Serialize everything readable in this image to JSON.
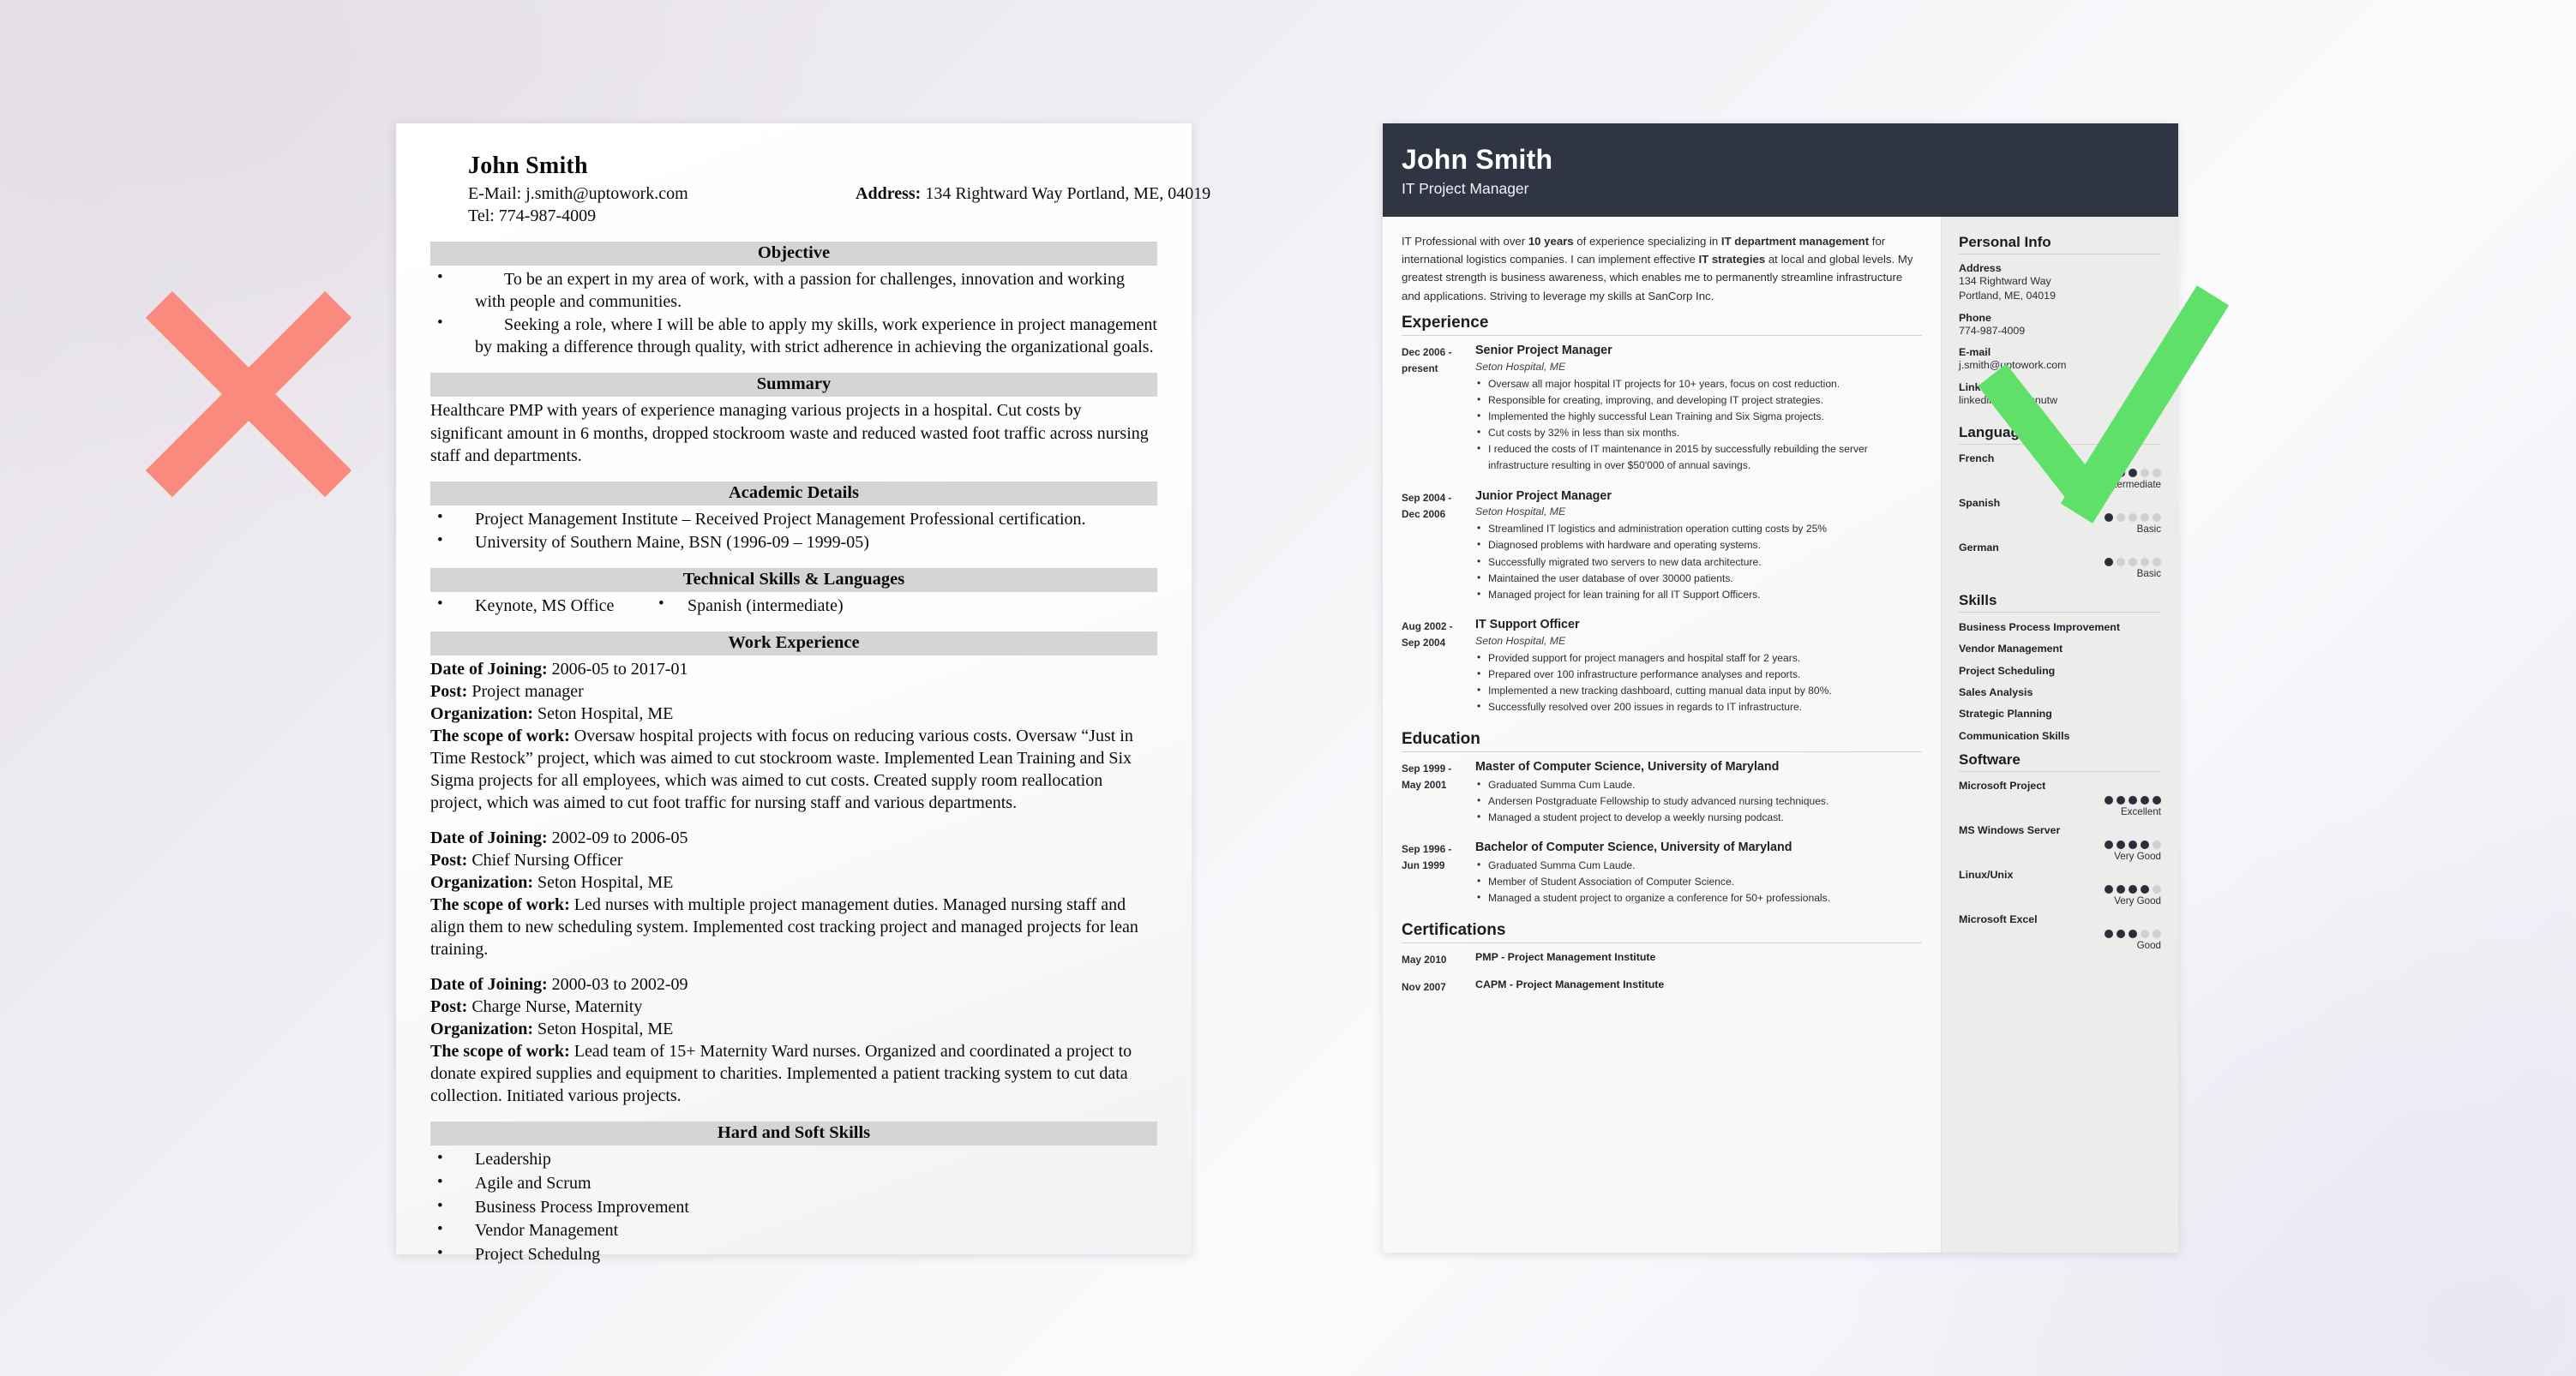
{
  "colors": {
    "background": "#eceaf3",
    "bad_mark": "#fa8a7e",
    "good_mark": "#5fe069",
    "right_header_bg": "#303544",
    "right_sidebar_bg": "#ececeb",
    "left_band_bg": "#d5d5d5",
    "dot_on": "#2b2e3b",
    "dot_off": "#d0d0d0"
  },
  "marks": {
    "bad": "red-x-mark",
    "good": "green-check-mark"
  },
  "bad_resume": {
    "name": "John Smith",
    "email_line": "E-Mail: j.smith@uptowork.com",
    "tel_line": "Tel: 774-987-4009",
    "address_label": "Address:",
    "address_value": "134 Rightward Way Portland, ME, 04019",
    "sections": {
      "objective": {
        "heading": "Objective",
        "items": [
          "To be an expert in my area of work, with a passion for challenges, innovation and working with people and communities.",
          "Seeking a role, where I will be able to apply my skills, work experience in project management by making a difference through quality, with strict adherence in achieving the organizational goals."
        ]
      },
      "summary": {
        "heading": "Summary",
        "text": "Healthcare PMP with years of experience managing various projects in a hospital. Cut costs by significant amount in 6 months, dropped stockroom waste and reduced wasted foot traffic across nursing staff and departments."
      },
      "academic": {
        "heading": "Academic Details",
        "items": [
          "Project Management Institute – Received Project Management Professional certification.",
          "University of Southern Maine, BSN (1996-09 – 1999-05)"
        ]
      },
      "technical": {
        "heading": "Technical Skills & Languages",
        "col1": "Keynote, MS Office",
        "col2": "Spanish (intermediate)"
      },
      "work": {
        "heading": "Work Experience",
        "jobs": [
          {
            "date_label": "Date of Joining:",
            "date_value": " 2006-05 to 2017-01",
            "post_label": "Post:",
            "post_value": " Project manager",
            "org_label": "Organization:",
            "org_value": " Seton Hospital, ME",
            "scope_label": "The scope of work:",
            "scope_value": " Oversaw hospital projects with focus on reducing various costs. Oversaw “Just in Time Restock” project, which was aimed to cut stockroom waste. Implemented Lean Training and Six Sigma projects for all employees, which was aimed to cut costs. Created supply room reallocation project, which was aimed to cut foot traffic for nursing staff and various departments."
          },
          {
            "date_label": "Date of Joining:",
            "date_value": " 2002-09 to 2006-05",
            "post_label": "Post:",
            "post_value": " Chief Nursing Officer",
            "org_label": "Organization:",
            "org_value": " Seton Hospital, ME",
            "scope_label": "The scope of work:",
            "scope_value": " Led nurses with multiple project management duties. Managed nursing staff and align them to new scheduling system. Implemented cost tracking project and managed projects for lean training."
          },
          {
            "date_label": "Date of Joining:",
            "date_value": " 2000-03 to 2002-09",
            "post_label": "Post:",
            "post_value": " Charge Nurse, Maternity",
            "org_label": "Organization:",
            "org_value": " Seton Hospital, ME",
            "scope_label": "The scope of work:",
            "scope_value": " Lead team of 15+ Maternity Ward nurses. Organized and coordinated a project to donate expired supplies and equipment to charities. Implemented a patient tracking system to cut data collection. Initiated various projects."
          }
        ]
      },
      "skills": {
        "heading": "Hard and Soft Skills",
        "items": [
          "Leadership",
          "Agile and Scrum",
          "Business Process Improvement",
          "Vendor Management",
          "Project Schedulng"
        ]
      }
    }
  },
  "good_resume": {
    "header": {
      "name": "John Smith",
      "role": "IT Project Manager"
    },
    "summary": {
      "part1": "IT Professional with over ",
      "b1": "10 years",
      "part2": " of experience specializing in ",
      "b2": "IT department management",
      "part3": " for international logistics companies. I can implement effective ",
      "b3": "IT strategies",
      "part4": " at local and global levels. My greatest strength is business awareness, which enables me to permanently streamline infrastructure and applications. Striving to leverage my skills at SanCorp Inc."
    },
    "experience": {
      "heading": "Experience",
      "entries": [
        {
          "date_from": "Dec 2006 -",
          "date_to": "present",
          "title": "Senior Project Manager",
          "org": "Seton Hospital, ME",
          "bullets": [
            "Oversaw all major hospital IT projects for 10+ years, focus on cost reduction.",
            "Responsible for creating, improving, and developing IT project strategies.",
            "Implemented the highly successful Lean Training and Six Sigma projects.",
            "Cut costs by 32% in less than six months.",
            "I reduced the costs of IT maintenance in 2015 by successfully rebuilding the server infrastructure resulting in over $50'000 of annual savings."
          ]
        },
        {
          "date_from": "Sep 2004 -",
          "date_to": "Dec 2006",
          "title": "Junior Project Manager",
          "org": "Seton Hospital, ME",
          "bullets": [
            "Streamlined IT logistics and administration operation cutting costs by 25%",
            "Diagnosed problems with hardware and operating systems.",
            "Successfully migrated two servers to new data architecture.",
            "Maintained the user database of over 30000 patients.",
            "Managed project for lean training for all IT Support Officers."
          ]
        },
        {
          "date_from": "Aug 2002 -",
          "date_to": "Sep 2004",
          "title": "IT Support Officer",
          "org": "Seton Hospital, ME",
          "bullets": [
            "Provided support for project managers and hospital staff for 2 years.",
            "Prepared over 100 infrastructure performance analyses and reports.",
            "Implemented a new tracking dashboard, cutting manual data input by 80%.",
            "Successfully resolved over 200 issues in regards to IT infrastructure."
          ]
        }
      ]
    },
    "education": {
      "heading": "Education",
      "entries": [
        {
          "date_from": "Sep 1999 -",
          "date_to": "May 2001",
          "title": "Master of Computer Science, University of Maryland",
          "bullets": [
            "Graduated Summa Cum Laude.",
            "Andersen Postgraduate Fellowship to study advanced nursing techniques.",
            "Managed a student project to develop a weekly nursing podcast."
          ]
        },
        {
          "date_from": "Sep 1996 -",
          "date_to": "Jun 1999",
          "title": "Bachelor of Computer Science, University of Maryland",
          "bullets": [
            "Graduated Summa Cum Laude.",
            "Member of Student Association of Computer Science.",
            "Managed a student project to organize a conference for 50+ professionals."
          ]
        }
      ]
    },
    "certifications": {
      "heading": "Certifications",
      "entries": [
        {
          "date": "May 2010",
          "name": "PMP - Project Management Institute"
        },
        {
          "date": "Nov 2007",
          "name": "CAPM - Project Management Institute"
        }
      ]
    },
    "sidebar": {
      "personal_info": {
        "heading": "Personal Info",
        "fields": [
          {
            "label": "Address",
            "value": "134 Rightward Way\nPortland, ME, 04019"
          },
          {
            "label": "Phone",
            "value": "774-987-4009"
          },
          {
            "label": "E-mail",
            "value": "j.smith@uptowork.com"
          },
          {
            "label": "LinkedIn",
            "value": "linkedin.com/johnutw"
          }
        ]
      },
      "languages": {
        "heading": "Languages",
        "items": [
          {
            "name": "French",
            "level": 3,
            "max": 5,
            "label": "Intermediate"
          },
          {
            "name": "Spanish",
            "level": 1,
            "max": 5,
            "label": "Basic"
          },
          {
            "name": "German",
            "level": 1,
            "max": 5,
            "label": "Basic"
          }
        ]
      },
      "skills": {
        "heading": "Skills",
        "items": [
          "Business Process Improvement",
          "Vendor Management",
          "Project Scheduling",
          "Sales Analysis",
          "Strategic Planning",
          "Communication Skills"
        ]
      },
      "software": {
        "heading": "Software",
        "items": [
          {
            "name": "Microsoft Project",
            "level": 5,
            "max": 5,
            "label": "Excellent"
          },
          {
            "name": "MS Windows Server",
            "level": 4,
            "max": 5,
            "label": "Very Good"
          },
          {
            "name": "Linux/Unix",
            "level": 4,
            "max": 5,
            "label": "Very Good"
          },
          {
            "name": "Microsoft Excel",
            "level": 3,
            "max": 5,
            "label": "Good"
          }
        ]
      }
    }
  }
}
